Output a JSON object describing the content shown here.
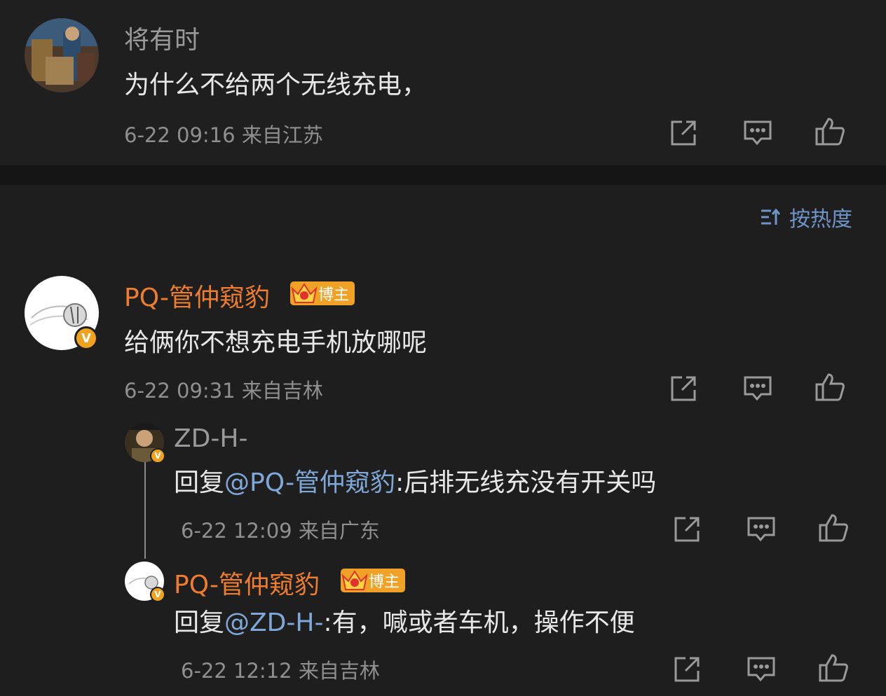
{
  "comment_top": {
    "author": "将有时",
    "text": "为什么不给两个无线充电，",
    "meta": "6-22 09:16 来自江苏"
  },
  "sort": {
    "label": "按热度",
    "icon": "sort-icon"
  },
  "comment_main": {
    "author": "PQ-管仲窥豹",
    "badge": "博主",
    "text": "给俩你不想充电手机放哪呢",
    "meta": "6-22 09:31 来自吉林",
    "verified": "V"
  },
  "reply_1": {
    "author": "ZD-H-",
    "prefix": "回复",
    "mention": "@PQ-管仲窥豹",
    "text": ":后排无线充没有开关吗",
    "meta": "6-22 12:09 来自广东",
    "verified": "V"
  },
  "reply_2": {
    "author": "PQ-管仲窥豹",
    "badge": "博主",
    "prefix": "回复",
    "mention": "@ZD-H-",
    "text": ":有，喊或者车机，操作不便",
    "meta": "6-22 12:12 来自吉林",
    "verified": "V"
  },
  "colors": {
    "background": "#1e1e1e",
    "accent_orange": "#ee7d2f",
    "mention_blue": "#7fa8d9",
    "badge_gold": "#f0a227"
  },
  "icons": [
    "share-icon",
    "comment-icon",
    "like-icon"
  ]
}
